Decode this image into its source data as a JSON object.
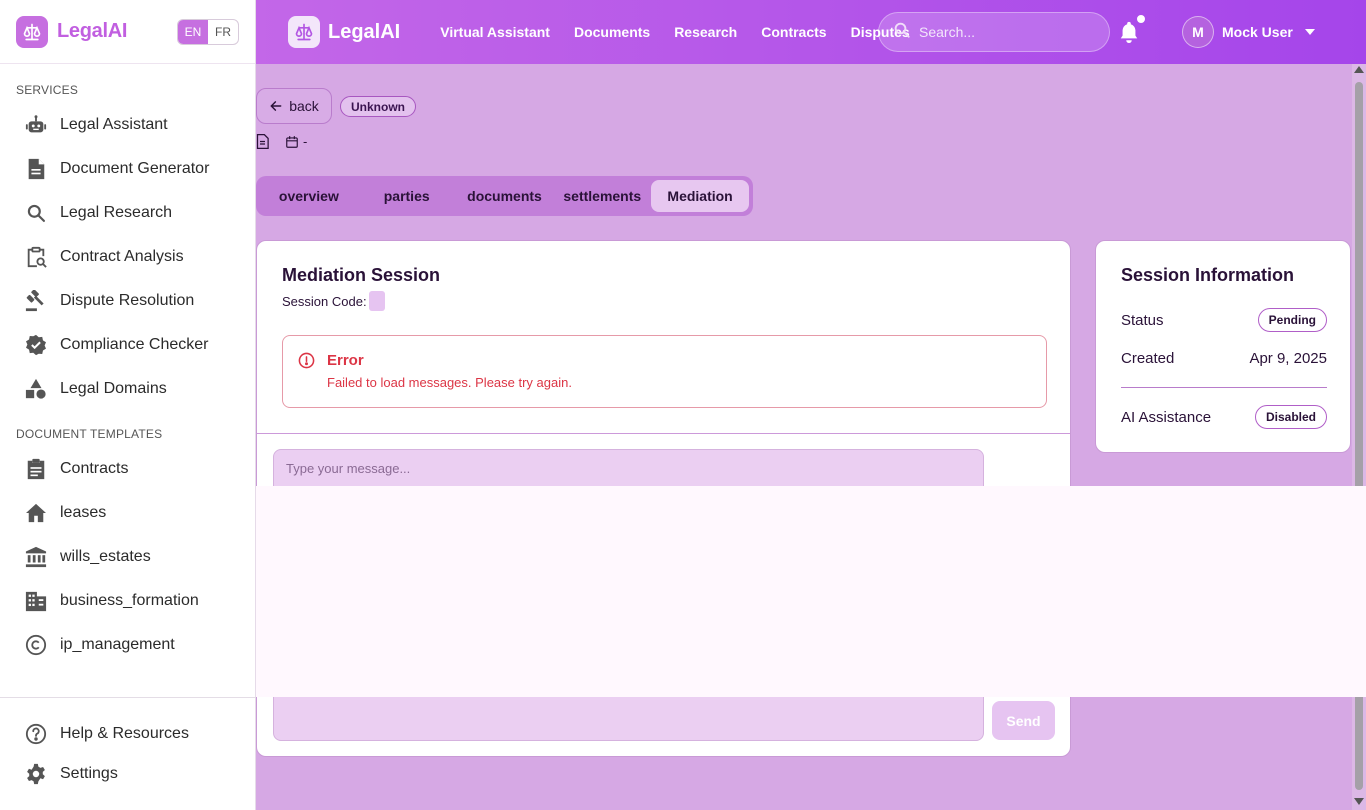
{
  "sidebar": {
    "brand": "LegalAI",
    "lang": {
      "en": "EN",
      "fr": "FR"
    },
    "services_heading": "SERVICES",
    "services": [
      {
        "label": "Legal Assistant",
        "icon": "robot-icon"
      },
      {
        "label": "Document Generator",
        "icon": "document-icon"
      },
      {
        "label": "Legal Research",
        "icon": "search-icon"
      },
      {
        "label": "Contract Analysis",
        "icon": "clipboard-search-icon"
      },
      {
        "label": "Dispute Resolution",
        "icon": "gavel-icon"
      },
      {
        "label": "Compliance Checker",
        "icon": "verified-badge-icon"
      },
      {
        "label": "Legal Domains",
        "icon": "shapes-icon"
      }
    ],
    "templates_heading": "DOCUMENT TEMPLATES",
    "templates": [
      {
        "label": "Contracts",
        "icon": "clipboard-icon"
      },
      {
        "label": "leases",
        "icon": "home-icon"
      },
      {
        "label": "wills_estates",
        "icon": "bank-icon"
      },
      {
        "label": "business_formation",
        "icon": "building-icon"
      },
      {
        "label": "ip_management",
        "icon": "copyright-icon"
      }
    ],
    "footer": [
      {
        "label": "Help & Resources",
        "icon": "help-circle-icon"
      },
      {
        "label": "Settings",
        "icon": "gear-icon"
      }
    ]
  },
  "topbar": {
    "brand": "LegalAI",
    "nav": [
      "Virtual Assistant",
      "Documents",
      "Research",
      "Contracts",
      "Disputes"
    ],
    "search_placeholder": "Search...",
    "user_initial": "M",
    "user_name": "Mock User"
  },
  "dispute": {
    "back_label": "back",
    "status_badge": "Unknown",
    "date": "-",
    "tabs": [
      "overview",
      "parties",
      "documents",
      "settlements",
      "Mediation"
    ],
    "active_tab": "Mediation"
  },
  "mediation": {
    "title": "Mediation Session",
    "session_code_label": "Session Code:",
    "error_title": "Error",
    "error_message": "Failed to load messages. Please try again.",
    "message_placeholder": "Type your message...",
    "send_label": "Send"
  },
  "session_info": {
    "title": "Session Information",
    "status_label": "Status",
    "status_value": "Pending",
    "created_label": "Created",
    "created_value": "Apr 9, 2025",
    "ai_label": "AI Assistance",
    "ai_value": "Disabled"
  },
  "colors": {
    "accent": "#c66fe0",
    "topbar_start": "#c367e8",
    "topbar_end": "#a545ea",
    "background": "#d6a8e4",
    "error": "#dc3545"
  }
}
